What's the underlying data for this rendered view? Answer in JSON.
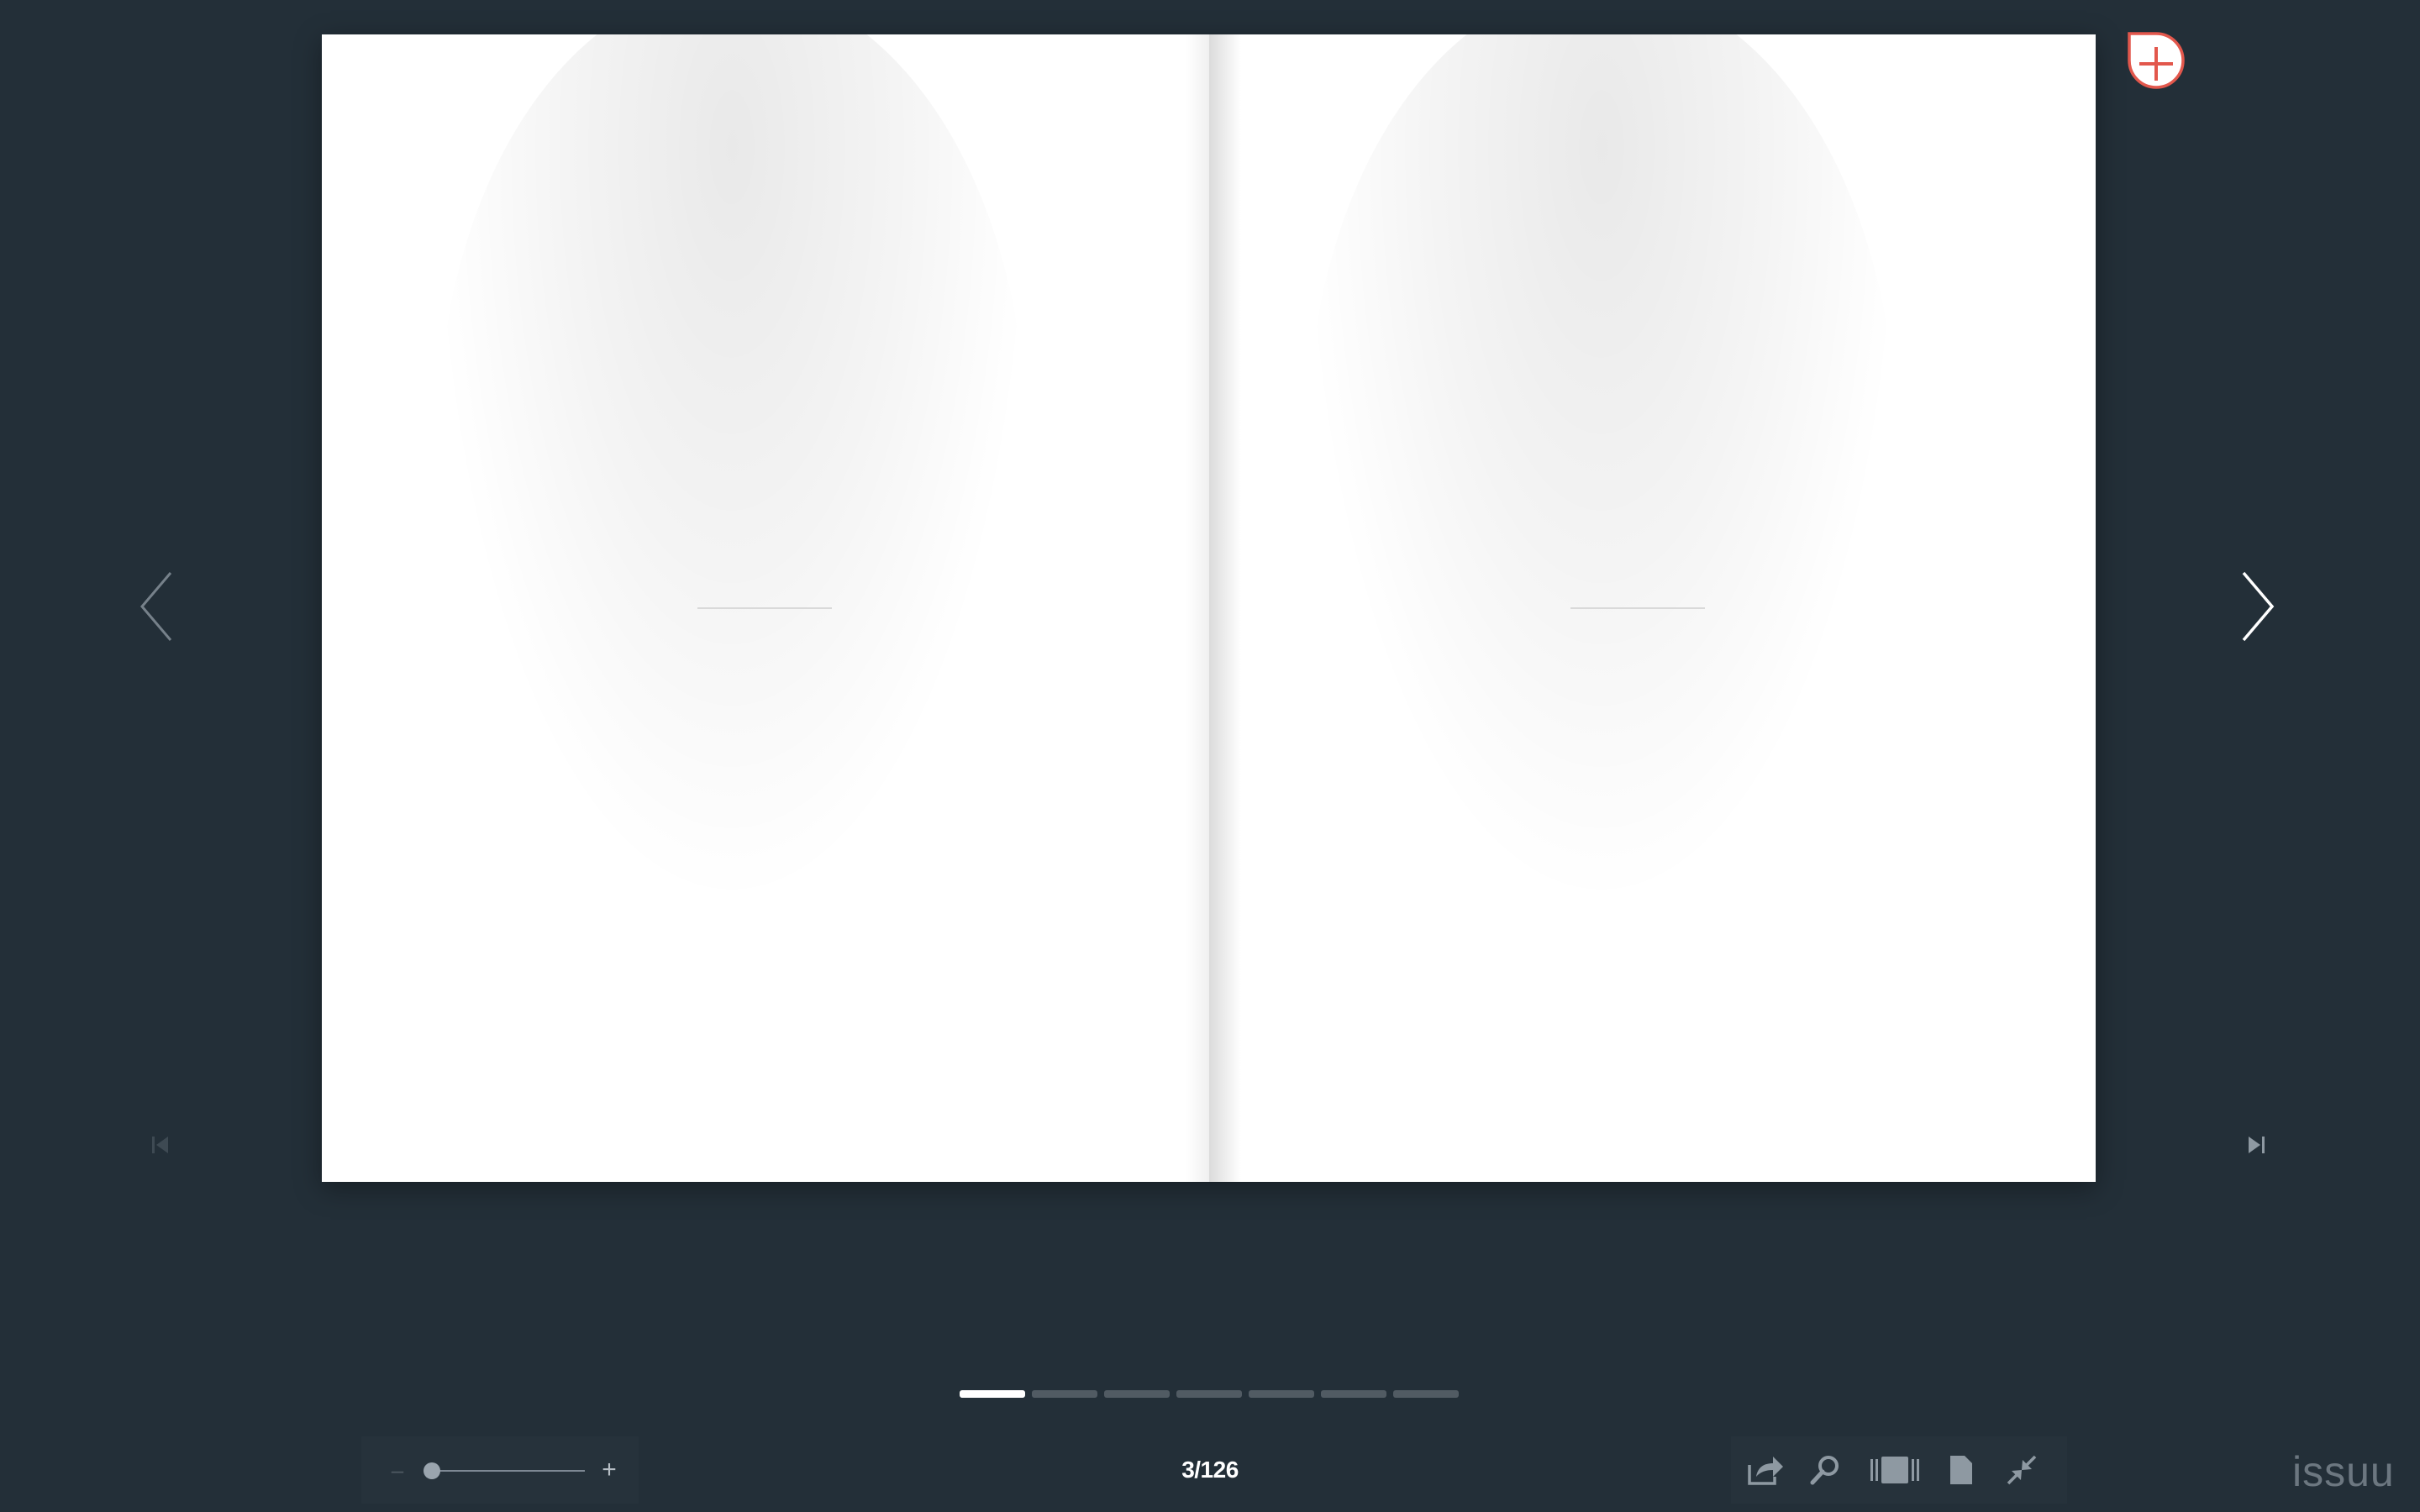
{
  "viewer": {
    "current_page_label": "3/126",
    "brand": "issuu",
    "page_dots": [
      {
        "active": true
      },
      {
        "active": false
      },
      {
        "active": false
      },
      {
        "active": false
      },
      {
        "active": false
      },
      {
        "active": false
      },
      {
        "active": false
      }
    ],
    "zoom": {
      "minus_label": "–",
      "plus_label": "+",
      "level": 0
    }
  },
  "icons": {
    "prev": "chevron-left-icon",
    "next": "chevron-right-icon",
    "first": "skip-to-first-icon",
    "last": "skip-to-last-icon",
    "add": "add-to-stack-icon",
    "share": "share-icon",
    "search": "search-icon",
    "thumbnails": "thumbnails-icon",
    "single_page": "single-page-icon",
    "exit_fullscreen": "exit-fullscreen-icon"
  },
  "colors": {
    "background": "#232f38",
    "page": "#ffffff",
    "accent": "#e2574c",
    "dot_active": "#ffffff",
    "dot_inactive": "#515b63"
  }
}
